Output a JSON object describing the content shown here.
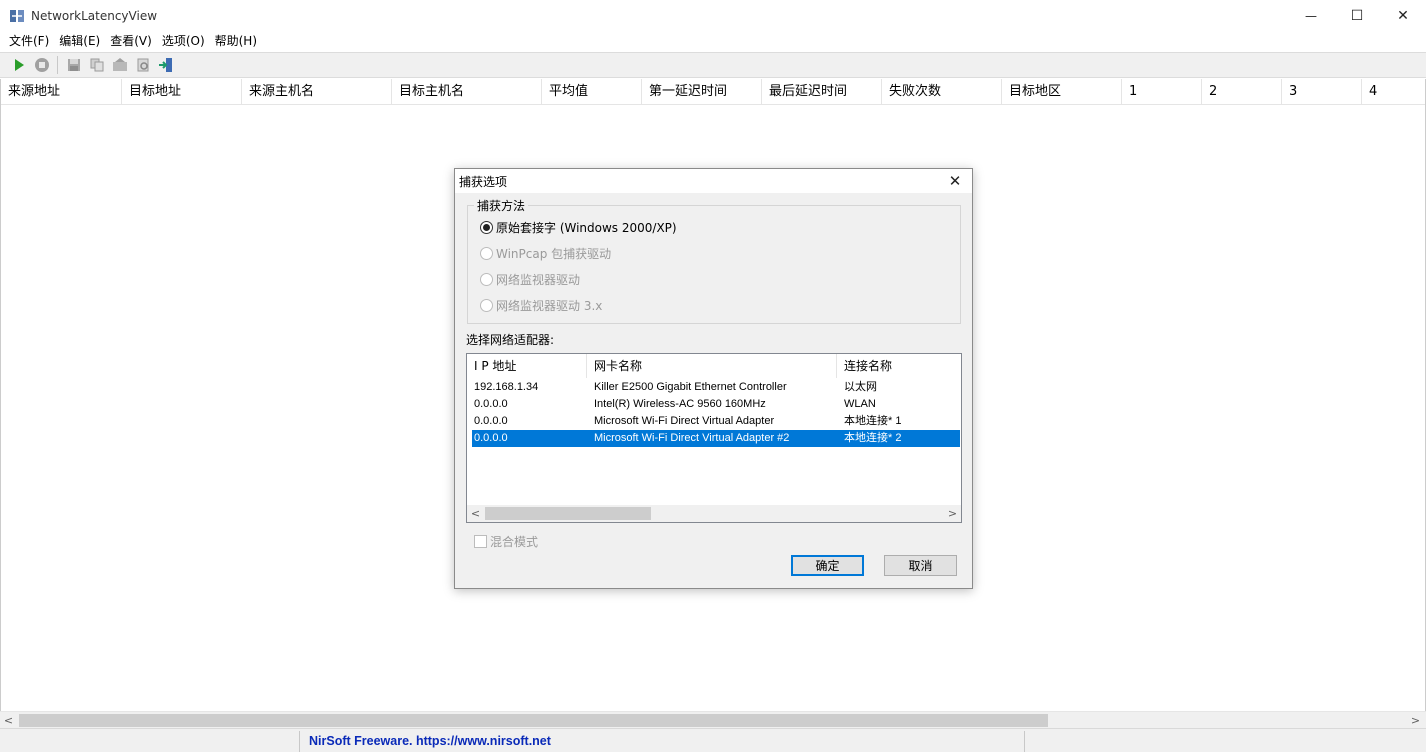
{
  "window": {
    "title": "NetworkLatencyView",
    "controls": {
      "minimize": "—",
      "maximize": "☐",
      "close": "✕"
    }
  },
  "menu": [
    "文件(F)",
    "编辑(E)",
    "查看(V)",
    "选项(O)",
    "帮助(H)"
  ],
  "toolbar": {
    "icons": [
      "start-capture-icon",
      "stop-capture-icon",
      "save-icon",
      "copy-icon",
      "properties-icon",
      "html-report-icon",
      "exit-icon"
    ]
  },
  "columns": [
    "来源地址",
    "目标地址",
    "来源主机名",
    "目标主机名",
    "平均值",
    "第一延迟时间",
    "最后延迟时间",
    "失败次数",
    "目标地区",
    "1",
    "2",
    "3",
    "4"
  ],
  "statusbar": {
    "text": "NirSoft Freeware.  https://www.nirsoft.net"
  },
  "scroll": {
    "left_arrow": "<",
    "right_arrow": ">"
  },
  "dialog": {
    "title": "捕获选项",
    "close": "✕",
    "capture_method": {
      "label": "捕获方法",
      "options": [
        {
          "label": "原始套接字 (Windows 2000/XP)",
          "checked": true,
          "enabled": true
        },
        {
          "label": "WinPcap 包捕获驱动",
          "checked": false,
          "enabled": false
        },
        {
          "label": "网络监视器驱动",
          "checked": false,
          "enabled": false
        },
        {
          "label": "网络监视器驱动 3.x",
          "checked": false,
          "enabled": false
        }
      ]
    },
    "adapter_label": "选择网络适配器:",
    "adapter_columns": [
      "I P 地址",
      "网卡名称",
      "连接名称"
    ],
    "adapters": [
      {
        "ip": "192.168.1.34",
        "name": "Killer E2500 Gigabit Ethernet Controller",
        "connection": "以太网",
        "selected": false
      },
      {
        "ip": "0.0.0.0",
        "name": "Intel(R) Wireless-AC 9560 160MHz",
        "connection": "WLAN",
        "selected": false
      },
      {
        "ip": "0.0.0.0",
        "name": "Microsoft Wi-Fi Direct Virtual Adapter",
        "connection": "本地连接* 1",
        "selected": false
      },
      {
        "ip": "0.0.0.0",
        "name": "Microsoft Wi-Fi Direct Virtual Adapter #2",
        "connection": "本地连接* 2",
        "selected": true
      }
    ],
    "promiscuous_mode": "混合模式",
    "ok_button": "确定",
    "cancel_button": "取消"
  },
  "colors": {
    "selection": "#0078d7",
    "statusbar_text": "#0a2ab8",
    "play_green": "#2a9d2a"
  }
}
